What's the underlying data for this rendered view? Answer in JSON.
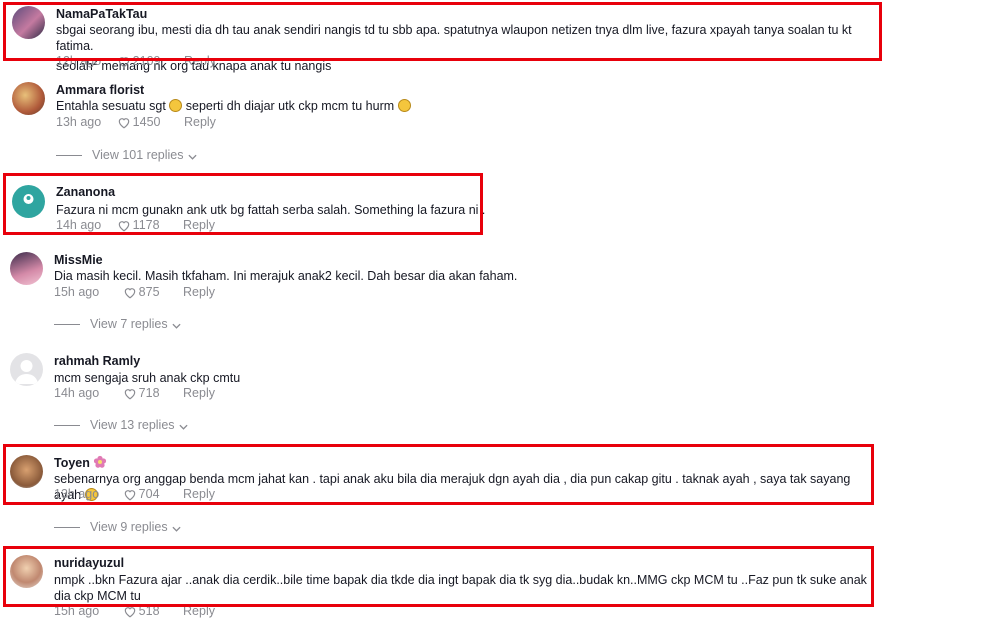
{
  "comments": [
    {
      "username": "NamaPaTakTau",
      "text": "sbgai seorang ibu, mesti dia dh tau anak sendiri nangis td tu sbb apa. spatutnya wlaupon netizen tnya dlm live, fazura xpayah tanya soalan tu kt fatima.",
      "text2_pre": "seolah",
      "text2_sup": "2",
      "text2_post": " memang nk org tau knapa anak tu nangis",
      "time": "12h ago",
      "likes": "2109",
      "reply": "Reply"
    },
    {
      "username": "Ammara florist",
      "text_pre": "Entahla sesuatu sgt ",
      "text_mid": " seperti dh diajar utk ckp mcm tu hurm ",
      "time": "13h ago",
      "likes": "1450",
      "reply": "Reply",
      "view_replies": "View 101 replies"
    },
    {
      "username": "Zananona",
      "text": "Fazura ni mcm gunakn ank utk bg fattah serba salah. Something la fazura ni .",
      "time": "14h ago",
      "likes": "1178",
      "reply": "Reply"
    },
    {
      "username": "MissMie",
      "text": "Dia masih kecil. Masih tkfaham. Ini merajuk anak2 kecil. Dah besar dia akan faham.",
      "time": "15h ago",
      "likes": "875",
      "reply": "Reply",
      "view_replies": "View 7 replies"
    },
    {
      "username": "rahmah Ramly",
      "text": "mcm sengaja sruh anak ckp cmtu",
      "time": "14h ago",
      "likes": "718",
      "reply": "Reply",
      "view_replies": "View 13 replies"
    },
    {
      "username": "Toyen",
      "text": "sebenarnya org anggap benda mcm jahat kan . tapi anak aku bila dia merajuk dgn ayah dia , dia pun cakap gitu . taknak ayah , saya tak sayang ayah ",
      "time": "13h ago",
      "likes": "704",
      "reply": "Reply",
      "view_replies": "View 9 replies"
    },
    {
      "username": "nuridayuzul",
      "text": "nmpk ..bkn Fazura ajar ..anak dia cerdik..bile time bapak dia tkde dia ingt bapak dia tk syg dia..budak kn..MMG ckp MCM tu ..Faz pun tk suke anak dia ckp MCM tu",
      "time": "15h ago",
      "likes": "518",
      "reply": "Reply"
    }
  ],
  "colors": {
    "highlight": "#e8000b",
    "meta": "#8a8b91",
    "text": "#161823"
  },
  "icons": {
    "like": "heart-outline-icon",
    "expand": "chevron-down-icon",
    "emoji_sad": "frowning-face-emoji",
    "emoji_laugh": "grinning-sweat-emoji",
    "flower": "flower-emoji"
  }
}
